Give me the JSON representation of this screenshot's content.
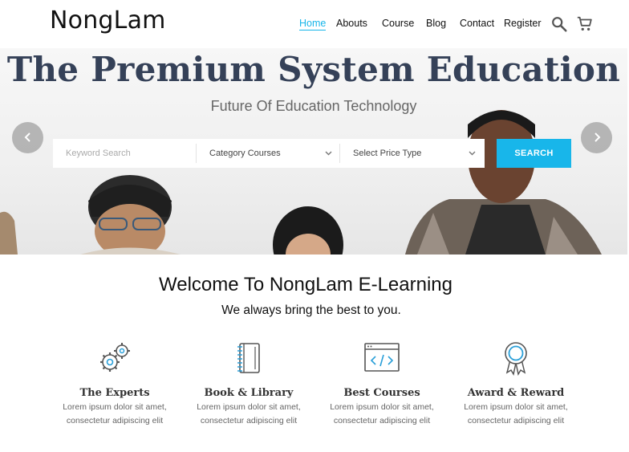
{
  "header": {
    "logo": "NongLam",
    "nav": [
      "Home",
      "Abouts",
      "Course",
      "Blog",
      "Contact",
      "Register"
    ],
    "icons": [
      "search-icon",
      "cart-icon"
    ]
  },
  "hero": {
    "title": "The Premium System Education",
    "subtitle": "Future Of Education Technology",
    "search": {
      "keyword_placeholder": "Keyword Search",
      "category_selected": "Category Courses",
      "price_selected": "Select Price Type",
      "button": "SEARCH"
    },
    "arrows": [
      "chevron-left-icon",
      "chevron-right-icon"
    ]
  },
  "welcome": {
    "title": "Welcome To NongLam E-Learning",
    "subtitle": "We always bring the best to you."
  },
  "features": [
    {
      "title": "The Experts",
      "desc1": "Lorem ipsum dolor sit amet,",
      "desc2": "consectetur adipiscing elit",
      "icon": "gears-icon"
    },
    {
      "title": "Book & Library",
      "desc1": "Lorem ipsum dolor sit amet,",
      "desc2": "consectetur adipiscing elit",
      "icon": "notebook-icon"
    },
    {
      "title": "Best Courses",
      "desc1": "Lorem ipsum dolor sit amet,",
      "desc2": "consectetur adipiscing elit",
      "icon": "code-window-icon"
    },
    {
      "title": "Award & Reward",
      "desc1": "Lorem ipsum dolor sit amet,",
      "desc2": "consectetur adipiscing elit",
      "icon": "award-icon"
    }
  ],
  "colors": {
    "accent": "#18b6ea",
    "hero_title": "#354158",
    "icon_blue": "#2a9fd8"
  }
}
